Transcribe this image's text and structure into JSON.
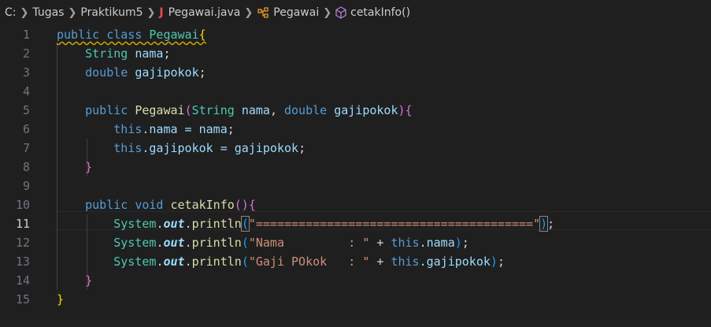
{
  "breadcrumb": {
    "items": [
      "C:",
      "Tugas",
      "Praktikum5",
      "Pegawai.java",
      "Pegawai",
      "cetakInfo()"
    ],
    "java_icon": "J"
  },
  "editor": {
    "line_numbers": [
      "1",
      "2",
      "3",
      "4",
      "5",
      "6",
      "7",
      "8",
      "9",
      "10",
      "11",
      "12",
      "13",
      "14",
      "15"
    ],
    "active_line": 11,
    "code": {
      "l1_public": "public",
      "l1_class": "class",
      "l1_name": "Pegawai",
      "l1_brace": "{",
      "l2_type": "String",
      "l2_var": "nama",
      "l2_semi": ";",
      "l3_type": "double",
      "l3_var": "gajipokok",
      "l3_semi": ";",
      "l5_public": "public",
      "l5_name": "Pegawai",
      "l5_open": "(",
      "l5_t1": "String",
      "l5_p1": "nama",
      "l5_comma": ", ",
      "l5_t2": "double",
      "l5_p2": "gajipokok",
      "l5_close": ")",
      "l5_brace": "{",
      "l6_this": "this",
      "l6_field": ".nama = ",
      "l6_val": "nama",
      "l6_semi": ";",
      "l7_this": "this",
      "l7_field": ".gajipokok = ",
      "l7_val": "gajipokok",
      "l7_semi": ";",
      "l8_brace": "}",
      "l10_public": "public",
      "l10_void": "void",
      "l10_name": "cetakInfo",
      "l10_parens": "()",
      "l10_brace": "{",
      "l11_sys": "System",
      "l11_out": "out",
      "l11_fn": "println",
      "l11_open": "(",
      "l11_str": "\"=======================================\"",
      "l11_close": ")",
      "l11_semi": ";",
      "l12_sys": "System",
      "l12_out": "out",
      "l12_fn": "println",
      "l12_open": "(",
      "l12_str": "\"Nama         : \"",
      "l12_plus": " + ",
      "l12_this": "this",
      "l12_field": ".nama",
      "l12_close": ")",
      "l12_semi": ";",
      "l13_sys": "System",
      "l13_out": "out",
      "l13_fn": "println",
      "l13_open": "(",
      "l13_str": "\"Gaji POkok   : \"",
      "l13_plus": " + ",
      "l13_this": "this",
      "l13_field": ".gajipokok",
      "l13_close": ")",
      "l13_semi": ";",
      "l14_brace": "}",
      "l15_brace": "}"
    }
  },
  "icons": {
    "lightbulb": "lightbulb-icon",
    "class": "class-icon",
    "method": "method-icon",
    "java": "java-file-icon",
    "chevron": "chevron-right-icon"
  },
  "colors": {
    "background": "#1f1f1f",
    "keyword": "#569cd6",
    "type": "#4ec9b0",
    "variable": "#9cdcfe",
    "function": "#dcdcaa",
    "string": "#ce9178",
    "bracket_gold": "#ffd700",
    "bracket_purple": "#da70d6"
  }
}
